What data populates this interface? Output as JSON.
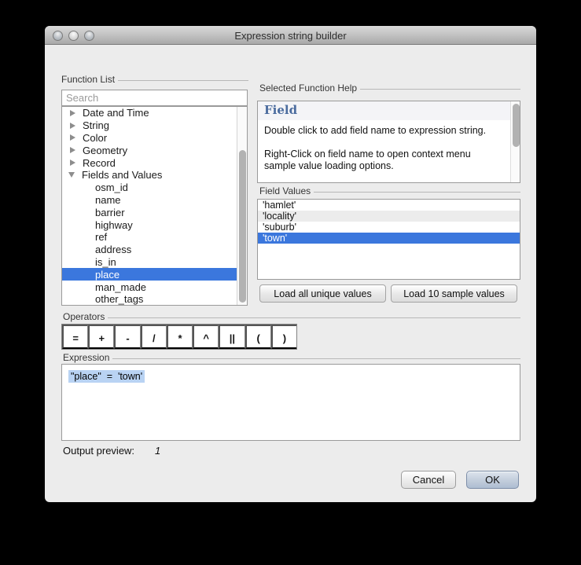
{
  "window": {
    "title": "Expression string builder"
  },
  "function_list": {
    "label": "Function List",
    "search_placeholder": "Search",
    "groups": [
      "Date and Time",
      "String",
      "Color",
      "Geometry",
      "Record",
      "Fields and Values"
    ],
    "fields": [
      "osm_id",
      "name",
      "barrier",
      "highway",
      "ref",
      "address",
      "is_in",
      "place",
      "man_made",
      "other_tags"
    ],
    "selected_field": "place"
  },
  "help": {
    "label": "Selected Function Help",
    "heading": "Field",
    "para1": "Double click to add field name to expression string.",
    "para2": "Right-Click on field name to open context menu sample value loading options."
  },
  "field_values": {
    "label": "Field Values",
    "values": [
      "'hamlet'",
      "'locality'",
      "'suburb'",
      "'town'"
    ],
    "selected_value": "'town'",
    "load_all_label": "Load all unique values",
    "load_sample_label": "Load 10 sample values"
  },
  "operators": {
    "label": "Operators",
    "buttons": [
      "=",
      "+",
      "-",
      "/",
      "*",
      "^",
      "||",
      "(",
      ")"
    ]
  },
  "expression": {
    "label": "Expression",
    "value": "\"place\"  =  'town'"
  },
  "output": {
    "label": "Output preview:",
    "value": "1"
  },
  "actions": {
    "cancel": "Cancel",
    "ok": "OK"
  },
  "colors": {
    "selection_blue": "#3b77dd",
    "expression_highlight": "#b9d3f3",
    "help_heading_blue": "#4a6b9e",
    "dialog_background": "#ececec"
  }
}
